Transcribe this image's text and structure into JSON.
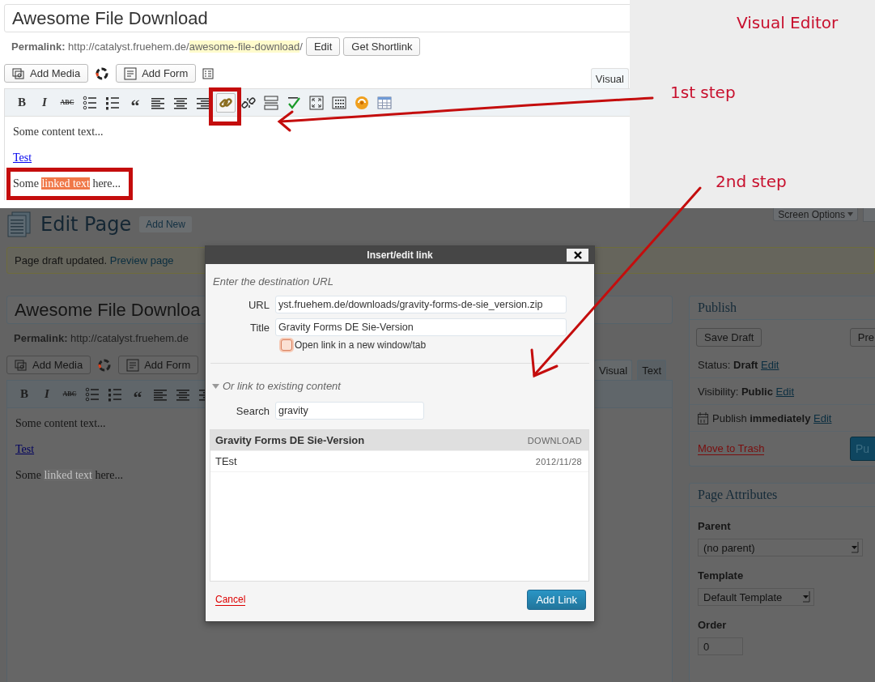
{
  "top": {
    "editor": {
      "title": "Awesome File Download",
      "permalink": {
        "label": "Permalink:",
        "base": "http://catalyst.fruehem.de/",
        "slug": "awesome-file-download",
        "end": "/"
      },
      "permalink_buttons": [
        "Edit",
        "Get Shortlink"
      ],
      "media_buttons": [
        {
          "kind": "media",
          "label": "Add Media"
        },
        {
          "kind": "form",
          "label": "Add Form"
        }
      ],
      "tabs": [
        {
          "label": "Visual",
          "selected": true
        }
      ],
      "toolbar": [
        {
          "kind": "bold",
          "label": "B",
          "framed": false
        },
        {
          "kind": "italic",
          "label": "I",
          "framed": false
        },
        {
          "kind": "strike",
          "label": "ABC",
          "framed": false
        },
        {
          "kind": "bullets",
          "framed": false
        },
        {
          "kind": "numbers",
          "framed": false
        },
        {
          "kind": "quote",
          "label": "“",
          "framed": false
        },
        {
          "kind": "alignleft",
          "framed": false
        },
        {
          "kind": "aligncenter",
          "framed": false
        },
        {
          "kind": "alignright",
          "framed": false
        },
        {
          "kind": "link",
          "framed": true
        },
        {
          "kind": "unlink",
          "framed": false
        },
        {
          "kind": "more",
          "framed": false
        },
        {
          "kind": "spellcheck",
          "framed": false
        },
        {
          "kind": "fullscreen",
          "framed": false
        },
        {
          "kind": "kitchensink",
          "framed": false
        },
        {
          "kind": "plugin",
          "framed": false
        },
        {
          "kind": "table",
          "framed": false
        }
      ],
      "content": [
        {
          "kind": "text",
          "text": "Some content text...",
          "framed": false
        },
        {
          "kind": "link",
          "text": "Test",
          "framed": false
        },
        {
          "kind": "selection",
          "before": "Some ",
          "highlight": "linked text",
          "after": " here...",
          "framed": true
        }
      ]
    },
    "annotations": [
      {
        "text": "Visual Editor"
      },
      {
        "text": "1st step"
      },
      {
        "text": "2nd step"
      }
    ]
  },
  "page": {
    "heading": "Edit Page",
    "add_new": "Add New",
    "screen_options": "Screen Options",
    "notice": {
      "text": "Page draft updated.",
      "link": "Preview page"
    },
    "editor": {
      "title": "Awesome File Downloa",
      "permalink": {
        "label": "Permalink:",
        "base": "http://catalyst.fruehem.de"
      },
      "media_buttons": [
        {
          "kind": "media",
          "label": "Add Media"
        },
        {
          "kind": "form",
          "label": "Add Form"
        }
      ],
      "tabs": [
        {
          "label": "Visual",
          "selected": true
        },
        {
          "label": "Text",
          "selected": false
        }
      ],
      "toolbar": [
        {
          "kind": "bold",
          "label": "B",
          "framed": false
        },
        {
          "kind": "italic",
          "label": "I",
          "framed": false
        },
        {
          "kind": "strike",
          "label": "ABC",
          "framed": false
        },
        {
          "kind": "bullets",
          "framed": false
        },
        {
          "kind": "numbers",
          "framed": false
        },
        {
          "kind": "quote",
          "label": "“",
          "framed": false
        },
        {
          "kind": "alignleft",
          "framed": false
        },
        {
          "kind": "aligncenter",
          "framed": false
        },
        {
          "kind": "alignright",
          "framed": false
        }
      ],
      "content": [
        {
          "kind": "text",
          "text": "Some content text...",
          "framed": false
        },
        {
          "kind": "link",
          "text": "Test",
          "framed": false
        },
        {
          "kind": "selection",
          "before": "Some ",
          "highlight": "linked text",
          "after": " here...",
          "framed": false
        }
      ]
    },
    "publish": {
      "title": "Publish",
      "buttons": [
        "Save Draft",
        "Pre"
      ],
      "rows": [
        {
          "kind": "status",
          "text": "Status: **Draft**",
          "link": "Edit"
        },
        {
          "kind": "visibility",
          "text": "Visibility: **Public**",
          "link": "Edit"
        },
        {
          "kind": "schedule",
          "text": "Publish **immediately**",
          "link": "Edit"
        }
      ],
      "trash": "Move to Trash",
      "publish_button": "Pu"
    },
    "attributes": {
      "title": "Page Attributes",
      "fields": [
        {
          "kind": "wide-select",
          "label": "Parent",
          "value": "(no parent)"
        },
        {
          "kind": "select",
          "label": "Template",
          "value": "Default Template"
        },
        {
          "kind": "text",
          "label": "Order",
          "value": "0"
        }
      ]
    }
  },
  "dialog": {
    "title": "Insert/edit link",
    "intro": "Enter the destination URL",
    "fields": [
      {
        "label": "URL",
        "value": "yst.fruehem.de/downloads/gravity-forms-de-sie_version.zip"
      },
      {
        "label": "Title",
        "value": "Gravity Forms DE Sie-Version"
      }
    ],
    "new_tab": {
      "label": "Open link in a new window/tab",
      "checked": false,
      "focused": true
    },
    "existing": {
      "label": "Or link to existing content",
      "expanded": true
    },
    "search": {
      "label": "Search",
      "value": "gravity"
    },
    "results": [
      {
        "title": "Gravity Forms DE Sie-Version",
        "meta": "DOWNLOAD",
        "selected": true
      },
      {
        "title": "TEst",
        "meta": "2012/11/28",
        "selected": false
      }
    ],
    "cancel": "Cancel",
    "submit": "Add Link"
  }
}
